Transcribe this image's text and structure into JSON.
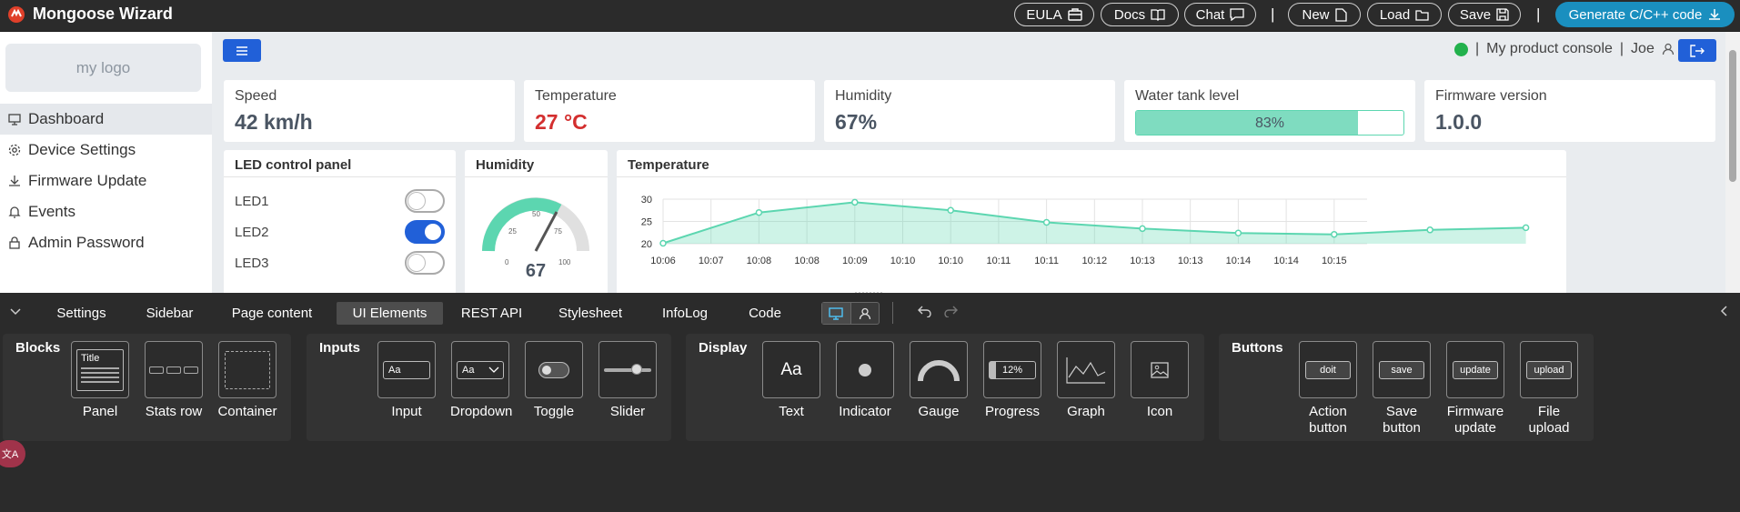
{
  "app": {
    "title": "Mongoose Wizard"
  },
  "topbar": {
    "eula": "EULA",
    "docs": "Docs",
    "chat": "Chat",
    "new": "New",
    "load": "Load",
    "save": "Save",
    "generate": "Generate C/C++ code"
  },
  "sidebar": {
    "logo": "my logo",
    "items": [
      {
        "label": "Dashboard",
        "icon": "monitor-icon",
        "active": true
      },
      {
        "label": "Device Settings",
        "icon": "gear-icon"
      },
      {
        "label": "Firmware Update",
        "icon": "download-icon"
      },
      {
        "label": "Events",
        "icon": "bell-icon"
      },
      {
        "label": "Admin Password",
        "icon": "lock-icon"
      }
    ]
  },
  "header": {
    "status_color": "#22b14c",
    "console_title": "My product console",
    "user": "Joe"
  },
  "stats": [
    {
      "label": "Speed",
      "value": "42 km/h"
    },
    {
      "label": "Temperature",
      "value": "27 °C",
      "color": "#d32f2f"
    },
    {
      "label": "Humidity",
      "value": "67%"
    },
    {
      "label": "Water tank level",
      "value": "83%",
      "level": 0.83
    },
    {
      "label": "Firmware version",
      "value": "1.0.0"
    }
  ],
  "led_panel": {
    "title": "LED control panel",
    "leds": [
      {
        "label": "LED1",
        "on": false
      },
      {
        "label": "LED2",
        "on": true
      },
      {
        "label": "LED3",
        "on": false
      }
    ]
  },
  "gauge_panel": {
    "title": "Humidity",
    "value": "67",
    "ticks": [
      "0",
      "25",
      "50",
      "75",
      "100"
    ]
  },
  "temp_panel": {
    "title": "Temperature"
  },
  "chart_data": {
    "type": "area",
    "x": [
      "10:06",
      "10:07",
      "10:08",
      "10:09",
      "10:10",
      "10:11",
      "10:12",
      "10:13",
      "10:14",
      "10:15"
    ],
    "points": [
      {
        "t": "10:06",
        "y": 20.1
      },
      {
        "t": "10:07",
        "y": 27.0
      },
      {
        "t": "10:08",
        "y": 29.3
      },
      {
        "t": "10:09",
        "y": 27.5
      },
      {
        "t": "10:10",
        "y": 24.8
      },
      {
        "t": "10:11",
        "y": 23.4
      },
      {
        "t": "10:12",
        "y": 22.4
      },
      {
        "t": "10:13",
        "y": 22.1
      },
      {
        "t": "10:14",
        "y": 23.1
      },
      {
        "t": "10:15",
        "y": 23.6
      }
    ],
    "xticks": [
      "10:06",
      "10:07",
      "10:08",
      "10:08",
      "10:09",
      "10:10",
      "10:10",
      "10:11",
      "10:11",
      "10:12",
      "10:13",
      "10:13",
      "10:14",
      "10:14",
      "10:15"
    ],
    "yticks": [
      "20",
      "25",
      "30"
    ],
    "ylim": [
      20,
      30
    ],
    "grid": true,
    "color": "#5cd6b0"
  },
  "tabs": [
    "Settings",
    "Sidebar",
    "Page content",
    "UI Elements",
    "REST API",
    "Stylesheet",
    "InfoLog",
    "Code"
  ],
  "active_tab": "UI Elements",
  "palette": {
    "blocks": {
      "title": "Blocks",
      "items": [
        "Panel",
        "Stats row",
        "Container"
      ],
      "panel_preview": "Title"
    },
    "inputs": {
      "title": "Inputs",
      "items": [
        "Input",
        "Dropdown",
        "Toggle",
        "Slider"
      ],
      "input_preview": "Aa"
    },
    "display": {
      "title": "Display",
      "items": [
        "Text",
        "Indicator",
        "Gauge",
        "Progress",
        "Graph",
        "Icon"
      ],
      "text_preview": "Aa",
      "progress_preview": "12%"
    },
    "buttons": {
      "title": "Buttons",
      "items": [
        {
          "line1": "Action",
          "line2": "button",
          "preview": "doit"
        },
        {
          "line1": "Save",
          "line2": "button",
          "preview": "save"
        },
        {
          "line1": "Firmware",
          "line2": "update",
          "preview": "update"
        },
        {
          "line1": "File",
          "line2": "upload",
          "preview": "upload"
        }
      ]
    }
  }
}
